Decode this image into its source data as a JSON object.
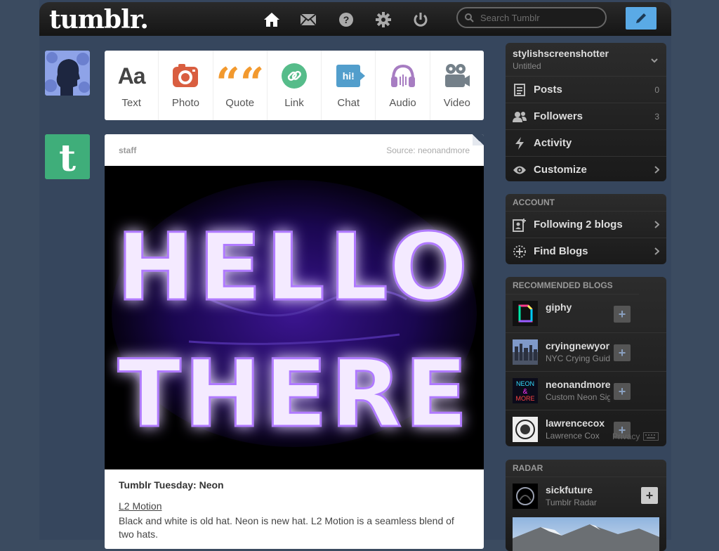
{
  "header": {
    "logo": "tumblr.",
    "search_placeholder": "Search Tumblr",
    "nav": [
      "home-icon",
      "mail-icon",
      "help-icon",
      "gear-icon",
      "power-icon"
    ]
  },
  "post_types": [
    {
      "label": "Text",
      "icon": "text-icon",
      "color": "#444444",
      "glyph": "Aa"
    },
    {
      "label": "Photo",
      "icon": "camera-icon",
      "color": "#d95e40"
    },
    {
      "label": "Quote",
      "icon": "quote-icon",
      "color": "#f2992e",
      "glyph": "““"
    },
    {
      "label": "Link",
      "icon": "link-icon",
      "color": "#56bc8a"
    },
    {
      "label": "Chat",
      "icon": "chat-icon",
      "color": "#529ecc",
      "glyph": "hi!"
    },
    {
      "label": "Audio",
      "icon": "headphones-icon",
      "color": "#a77dc2"
    },
    {
      "label": "Video",
      "icon": "video-camera-icon",
      "color": "#748089"
    }
  ],
  "post": {
    "author": "staff",
    "source": "Source: neonandmore",
    "image_text_1": "HELLO",
    "image_text_2": "THERE",
    "title": "Tumblr Tuesday: Neon",
    "link": "L2 Motion",
    "body": "Black and white is old hat. Neon is new hat. L2 Motion is a seamless blend of two hats."
  },
  "blog": {
    "name": "stylishscreenshotter",
    "title": "Untitled",
    "items": [
      {
        "label": "Posts",
        "count": "0",
        "icon": "posts-icon"
      },
      {
        "label": "Followers",
        "count": "3",
        "icon": "followers-icon"
      },
      {
        "label": "Activity",
        "icon": "activity-icon"
      },
      {
        "label": "Customize",
        "icon": "eye-icon"
      }
    ]
  },
  "account": {
    "heading": "ACCOUNT",
    "items": [
      {
        "label": "Following 2 blogs",
        "icon": "following-icon"
      },
      {
        "label": "Find Blogs",
        "icon": "find-blogs-icon"
      }
    ]
  },
  "recommended": {
    "heading": "RECOMMENDED BLOGS",
    "items": [
      {
        "name": "giphy",
        "sub": ""
      },
      {
        "name": "cryingnewyork",
        "sub": "NYC Crying Guide"
      },
      {
        "name": "neonandmore",
        "sub": "Custom Neon Signs",
        "thumb_text_1": "NEON",
        "thumb_text_2": "MORE"
      },
      {
        "name": "lawrencecox",
        "sub": "Lawrence Cox"
      }
    ],
    "footer": "Privacy"
  },
  "radar": {
    "heading": "RADAR",
    "name": "sickfuture",
    "sub": "Tumblr Radar"
  }
}
